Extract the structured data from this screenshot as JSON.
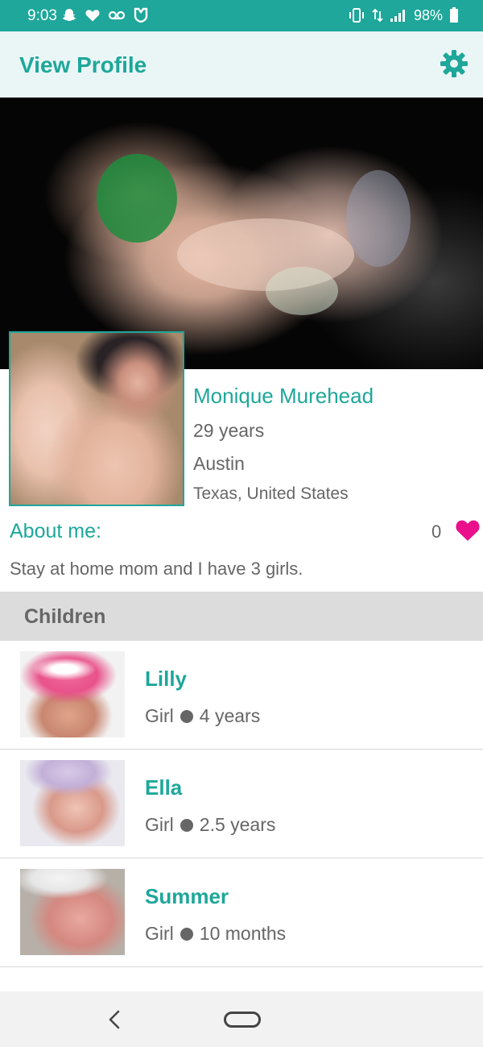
{
  "status_bar": {
    "time": "9:03",
    "battery": "98%",
    "left_icons": [
      "snapchat-icon",
      "heart-icon",
      "voicemail-icon",
      "shield-icon"
    ],
    "right_icons": [
      "vibrate-icon",
      "data-icon",
      "signal-icon",
      "battery-icon"
    ],
    "background_color": "#1ea79a"
  },
  "app_bar": {
    "title": "View Profile",
    "settings_icon": "gear-icon",
    "accent_color": "#1ea79a"
  },
  "profile": {
    "name": "Monique Murehead",
    "age": "29 years",
    "city": "Austin",
    "region": "Texas, United States"
  },
  "about": {
    "heading": "About me:",
    "likes": "0",
    "text": "Stay at home mom and I have 3 girls.",
    "like_color": "#ea0f8b"
  },
  "children": {
    "title": "Children",
    "items": [
      {
        "name": "Lilly",
        "gender": "Girl",
        "age": "4 years"
      },
      {
        "name": "Ella",
        "gender": "Girl",
        "age": "2.5 years"
      },
      {
        "name": "Summer",
        "gender": "Girl",
        "age": "10 months"
      }
    ]
  },
  "nav": {
    "icons": [
      "back-icon",
      "home-icon"
    ]
  }
}
